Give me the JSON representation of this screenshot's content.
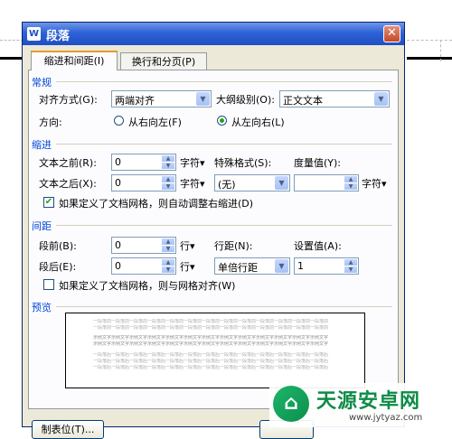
{
  "window": {
    "title": "段落",
    "app_icon": "W",
    "close_glyph": "✕"
  },
  "tabs": [
    {
      "label": "缩进和间距(I)",
      "active": true
    },
    {
      "label": "换行和分页(P)",
      "active": false
    }
  ],
  "general": {
    "heading": "常规",
    "alignment_label": "对齐方式(G):",
    "alignment_value": "两端对齐",
    "outline_label": "大纲级别(O):",
    "outline_value": "正文文本",
    "direction_label": "方向:",
    "direction_rtl": "从右向左(F)",
    "direction_ltr": "从左向右(L)",
    "direction_selected": "ltr"
  },
  "indent": {
    "heading": "缩进",
    "before_label": "文本之前(R):",
    "before_value": "0",
    "before_unit": "字符",
    "after_label": "文本之后(X):",
    "after_value": "0",
    "after_unit": "字符",
    "special_label": "特殊格式(S):",
    "special_value": "(无)",
    "measure_label": "度量值(Y):",
    "measure_value": "",
    "measure_unit": "字符",
    "auto_adjust_label": "如果定义了文档网格，则自动调整右缩进(D)",
    "auto_adjust_checked": true
  },
  "spacing": {
    "heading": "间距",
    "before_label": "段前(B):",
    "before_value": "0",
    "before_unit": "行",
    "after_label": "段后(E):",
    "after_value": "0",
    "after_unit": "行",
    "line_label": "行距(N):",
    "line_value": "单倍行距",
    "setting_label": "设置值(A):",
    "setting_value": "1",
    "snap_grid_label": "如果定义了文档网格，则与网格对齐(W)",
    "snap_grid_checked": false
  },
  "preview": {
    "heading": "预览"
  },
  "buttons": {
    "tabs_label": "制表位(T)..."
  },
  "watermark": {
    "title": "天源安卓网",
    "url": "www.jytyaz.com"
  },
  "colors": {
    "titlebar": "#2e62d6",
    "dialog_bg": "#ece9d8",
    "section_heading": "#0046d5",
    "radio_selected": "#21a121",
    "watermark_green": "#0d8b47"
  }
}
